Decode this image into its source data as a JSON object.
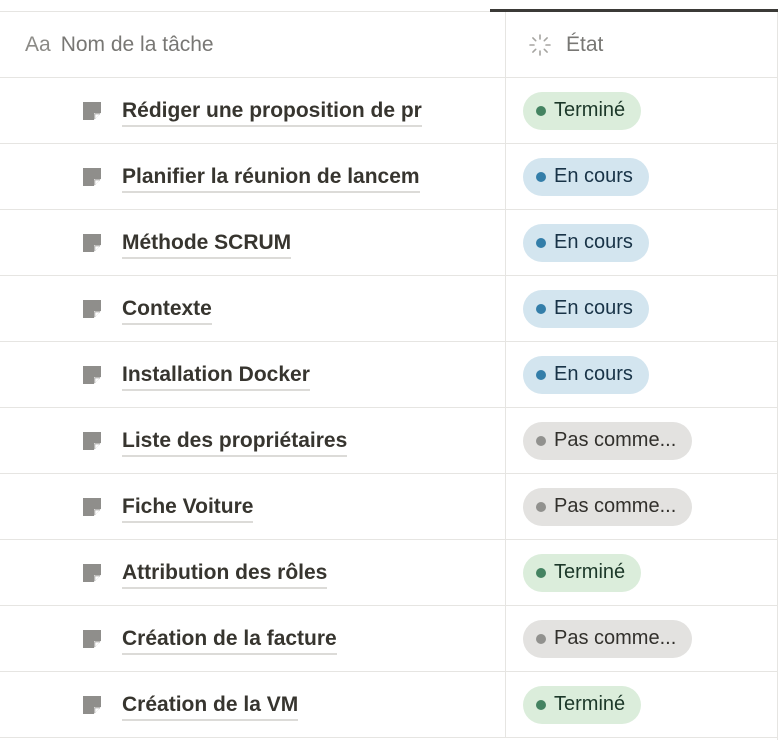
{
  "table": {
    "header": {
      "title_icon": "Aa",
      "name_label": "Nom de la tâche",
      "state_icon": "spinner-icon",
      "state_label": "État"
    },
    "rows": [
      {
        "title": "Rédiger une proposition de pr",
        "state": "Terminé",
        "state_kind": "done"
      },
      {
        "title": "Planifier la réunion de lancem",
        "state": "En cours",
        "state_kind": "progress"
      },
      {
        "title": "Méthode SCRUM",
        "state": "En cours",
        "state_kind": "progress"
      },
      {
        "title": "Contexte",
        "state": "En cours",
        "state_kind": "progress"
      },
      {
        "title": "Installation Docker",
        "state": "En cours",
        "state_kind": "progress"
      },
      {
        "title": "Liste des propriétaires",
        "state": "Pas comme...",
        "state_kind": "todo"
      },
      {
        "title": "Fiche Voiture",
        "state": "Pas comme...",
        "state_kind": "todo"
      },
      {
        "title": "Attribution des rôles",
        "state": "Terminé",
        "state_kind": "done"
      },
      {
        "title": "Création de la facture",
        "state": "Pas comme...",
        "state_kind": "todo"
      },
      {
        "title": "Création de la VM",
        "state": "Terminé",
        "state_kind": "done"
      }
    ]
  },
  "colors": {
    "done_bg": "#dbeddb",
    "done_dot": "#448361",
    "progress_bg": "#d3e5ef",
    "progress_dot": "#337ea9",
    "todo_bg": "#e3e2e0",
    "todo_dot": "#91918e",
    "page_icon": "#8f8e8b"
  },
  "icons": {
    "row_icon": "page-icon"
  }
}
